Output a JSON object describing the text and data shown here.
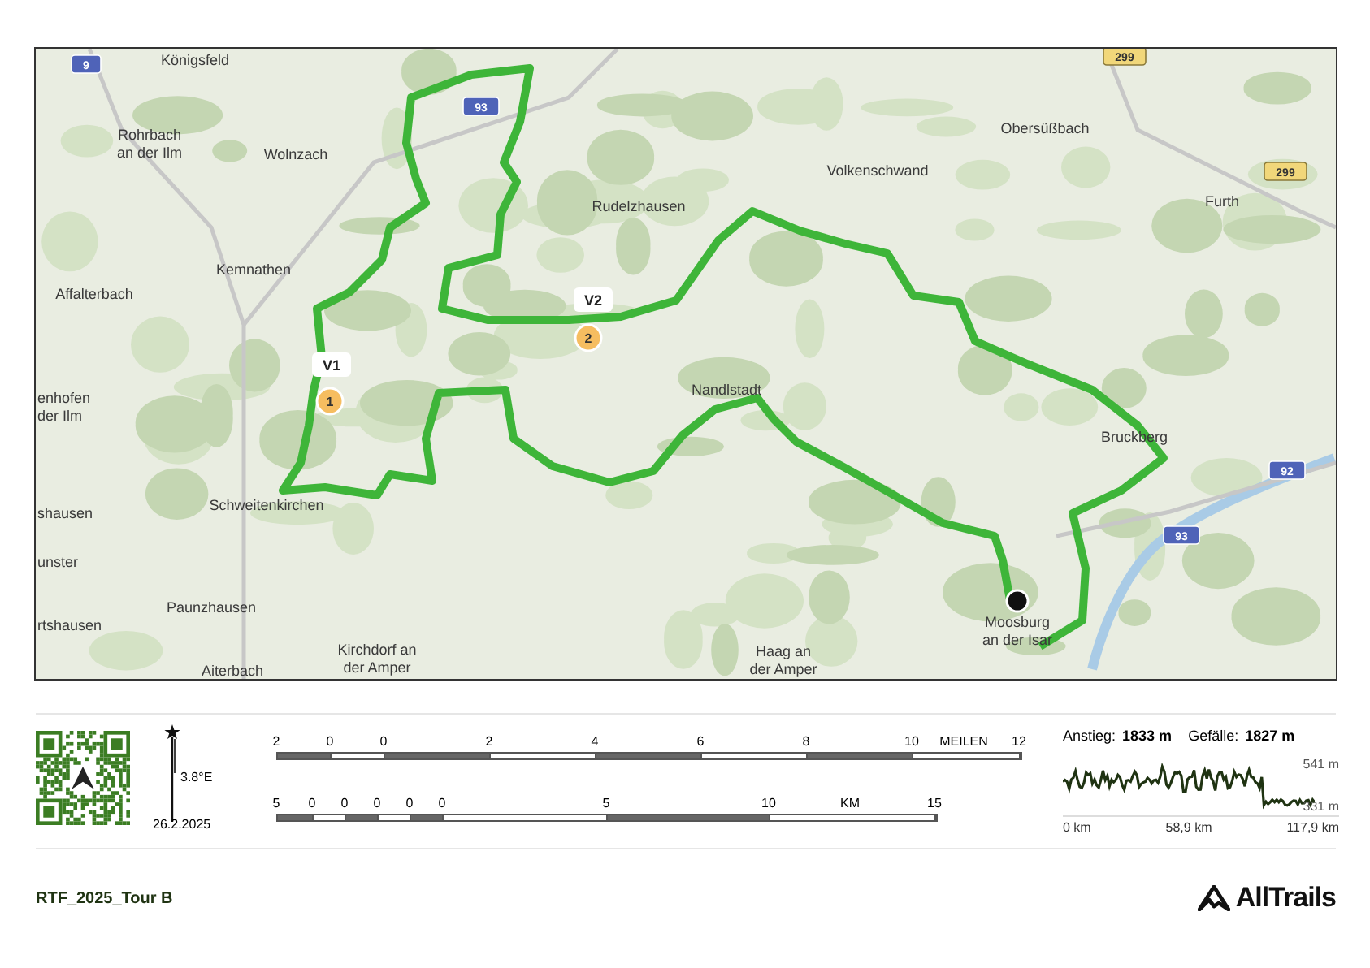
{
  "map": {
    "places": [
      {
        "lines": [
          "Königsfeld"
        ]
      },
      {
        "lines": [
          "Rohrbach",
          "an der Ilm"
        ]
      },
      {
        "lines": [
          "Wolnzach"
        ]
      },
      {
        "lines": [
          "Kemnathen"
        ]
      },
      {
        "lines": [
          "Affalterbach"
        ]
      },
      {
        "lines": [
          "enhofen",
          "der Ilm"
        ]
      },
      {
        "lines": [
          "Rudelzhausen"
        ]
      },
      {
        "lines": [
          "Volkenschwand"
        ]
      },
      {
        "lines": [
          "Obersüßbach"
        ]
      },
      {
        "lines": [
          "Furth"
        ]
      },
      {
        "lines": [
          "Nandlstadt"
        ]
      },
      {
        "lines": [
          "Bruckberg"
        ]
      },
      {
        "lines": [
          "Schweitenkirchen"
        ]
      },
      {
        "lines": [
          "shausen"
        ]
      },
      {
        "lines": [
          "unster"
        ]
      },
      {
        "lines": [
          "rtshausen"
        ]
      },
      {
        "lines": [
          "Paunzhausen"
        ]
      },
      {
        "lines": [
          "Aiterbach"
        ]
      },
      {
        "lines": [
          "Kirchdorf an",
          "der Amper"
        ]
      },
      {
        "lines": [
          "Haag an",
          "der Amper"
        ]
      },
      {
        "lines": [
          "Moosburg",
          "an der Isar"
        ]
      }
    ],
    "road_shields": [
      {
        "number": "9",
        "kind": "motorway"
      },
      {
        "number": "93",
        "kind": "motorway"
      },
      {
        "number": "299",
        "kind": "federal"
      },
      {
        "number": "299",
        "kind": "federal"
      },
      {
        "number": "92",
        "kind": "motorway"
      },
      {
        "number": "93",
        "kind": "motorway"
      }
    ],
    "waypoints": [
      {
        "label": "V1",
        "number": "1"
      },
      {
        "label": "V2",
        "number": "2"
      }
    ]
  },
  "legend": {
    "north": {
      "declination": "3.8°E",
      "date": "26.2.2025"
    },
    "scale_miles": {
      "ticks": [
        "2",
        "0",
        "0",
        "2",
        "4",
        "6",
        "8",
        "10",
        "MEILEN",
        "12"
      ]
    },
    "scale_km": {
      "ticks": [
        "5",
        "0",
        "0",
        "0",
        "0",
        "0",
        "5",
        "10",
        "KM",
        "15"
      ]
    }
  },
  "stats": {
    "ascent_label": "Anstieg:",
    "ascent": "1833 m",
    "descent_label": "Gefälle:",
    "descent": "1827 m",
    "elevation": {
      "max": "541 m",
      "min": "331 m",
      "start": "0 km",
      "middle": "58,9 km",
      "end": "117,9 km"
    }
  },
  "footer": {
    "title": "RTF_2025_Tour B",
    "brand": "AllTrails"
  }
}
